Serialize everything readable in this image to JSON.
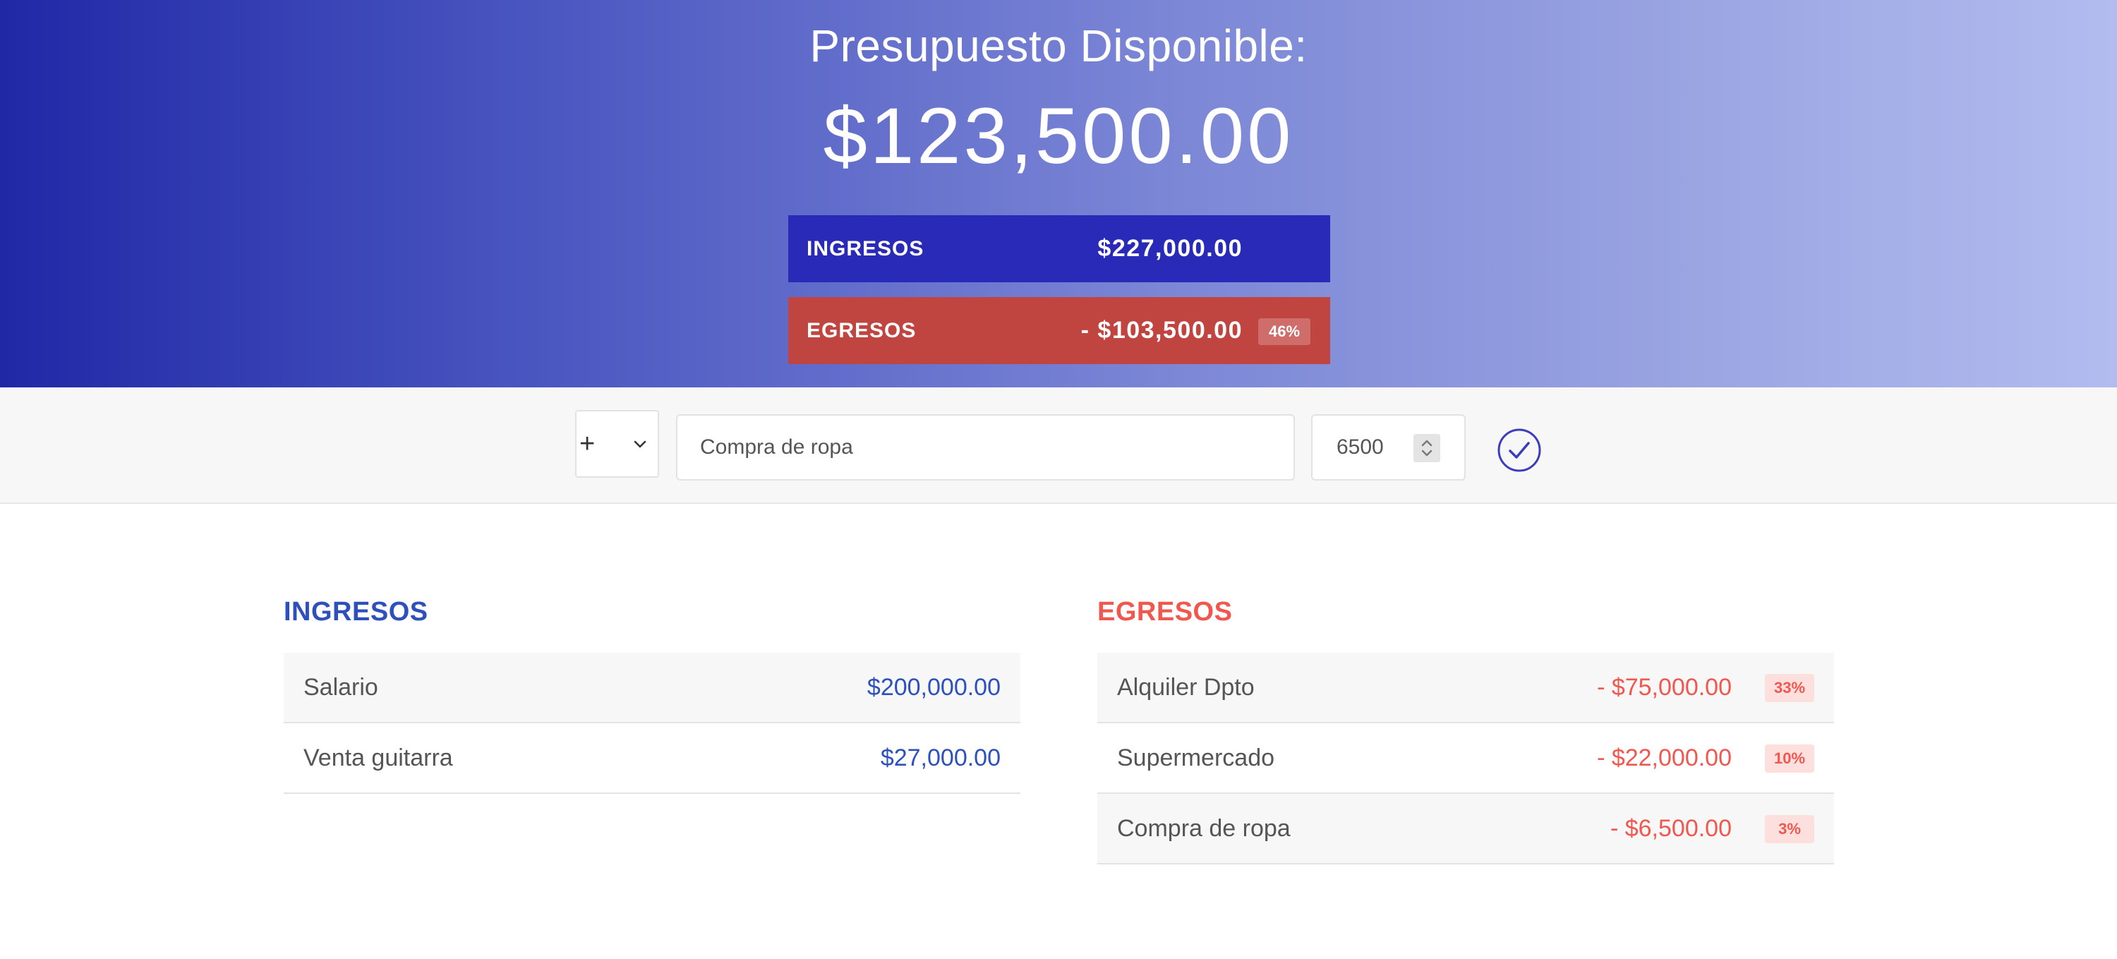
{
  "header": {
    "title": "Presupuesto Disponible:",
    "available_budget": "$123,500.00",
    "gradient_colors": [
      "#2028a6",
      "#b3bcef"
    ]
  },
  "summary": {
    "income": {
      "label": "INGRESOS",
      "value": "$227,000.00",
      "color": "#2a2ab8"
    },
    "expenses": {
      "label": "EGRESOS",
      "value": "- $103,500.00",
      "percentage": "46%",
      "color": "#c04440"
    }
  },
  "add_form": {
    "type_selected": "+",
    "type_icon": "chevron-down-icon",
    "description_value": "Compra de ropa",
    "amount_value": "6500",
    "submit_icon": "check-circle-icon"
  },
  "income_list": {
    "title": "INGRESOS",
    "color": "#2e50bd",
    "items": [
      {
        "description": "Salario",
        "value": "$200,000.00"
      },
      {
        "description": "Venta guitarra",
        "value": "$27,000.00"
      }
    ]
  },
  "expense_list": {
    "title": "EGRESOS",
    "color": "#f0574f",
    "items": [
      {
        "description": "Alquiler Dpto",
        "value": "- $75,000.00",
        "percentage": "33%"
      },
      {
        "description": "Supermercado",
        "value": "- $22,000.00",
        "percentage": "10%"
      },
      {
        "description": "Compra de ropa",
        "value": "- $6,500.00",
        "percentage": "3%"
      }
    ]
  }
}
